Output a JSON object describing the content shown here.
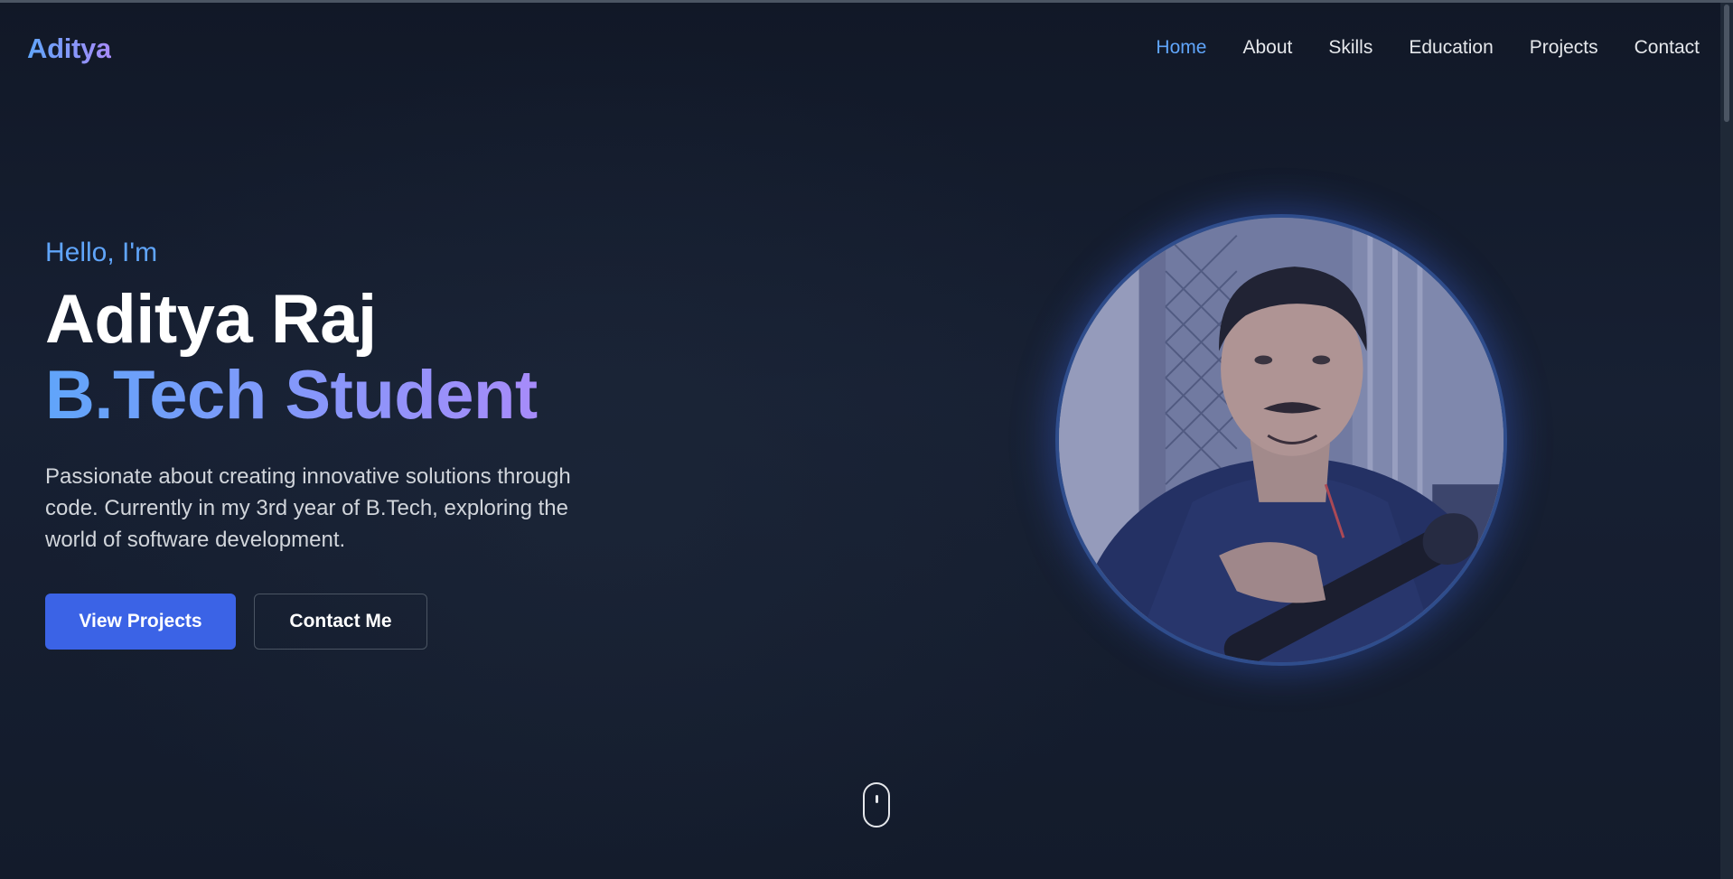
{
  "navbar": {
    "logo": "Aditya",
    "links": [
      {
        "label": "Home",
        "active": true
      },
      {
        "label": "About",
        "active": false
      },
      {
        "label": "Skills",
        "active": false
      },
      {
        "label": "Education",
        "active": false
      },
      {
        "label": "Projects",
        "active": false
      },
      {
        "label": "Contact",
        "active": false
      }
    ]
  },
  "hero": {
    "greeting": "Hello, I'm",
    "name": "Aditya Raj",
    "role": "B.Tech Student",
    "description": "Passionate about creating innovative solutions through code. Currently in my 3rd year of B.Tech, exploring the world of software development.",
    "primary_button": "View Projects",
    "secondary_button": "Contact Me"
  },
  "colors": {
    "background": "#111827",
    "accent_blue": "#60a5fa",
    "accent_purple": "#a78bfa",
    "button_primary": "#3b63e6",
    "text": "#e5e7eb"
  },
  "icons": {
    "scroll": "mouse-scroll-icon"
  }
}
